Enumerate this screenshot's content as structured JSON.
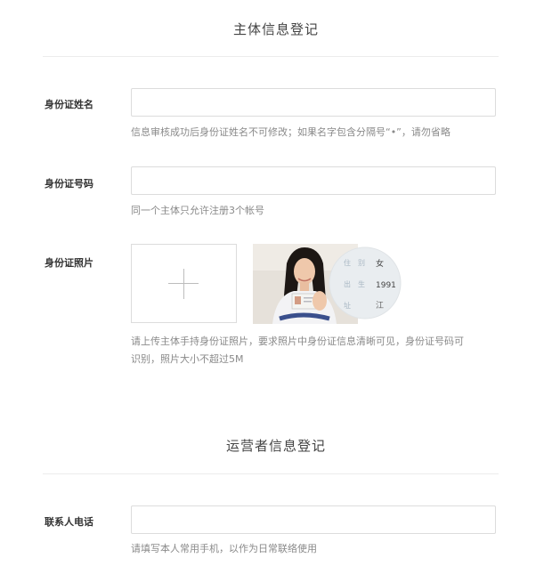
{
  "subject_section": {
    "title": "主体信息登记",
    "fields": [
      {
        "label": "身份证姓名",
        "value": "",
        "hint": "信息审核成功后身份证姓名不可修改；如果名字包含分隔号“•”，请勿省略"
      },
      {
        "label": "身份证号码",
        "value": "",
        "hint": "同一个主体只允许注册3个帐号"
      }
    ],
    "photo": {
      "label": "身份证照片",
      "upload_icon": "plus-icon",
      "sample_card_text": [
        "住",
        "别",
        "女",
        "出",
        "生",
        "1991",
        "址",
        "江"
      ],
      "hint_line1": "请上传主体手持身份证照片，要求照片中身份证信息清晰可见，身份证号码可",
      "hint_line2": "识别，照片大小不超过5M"
    }
  },
  "operator_section": {
    "title": "运营者信息登记",
    "fields": [
      {
        "label": "联系人电话",
        "value": "",
        "hint": "请填写本人常用手机，以作为日常联络使用"
      }
    ]
  },
  "colors": {
    "label": "#333333",
    "hint": "#8a8a8a",
    "border": "#dcdcdc",
    "divider": "#ececec"
  }
}
